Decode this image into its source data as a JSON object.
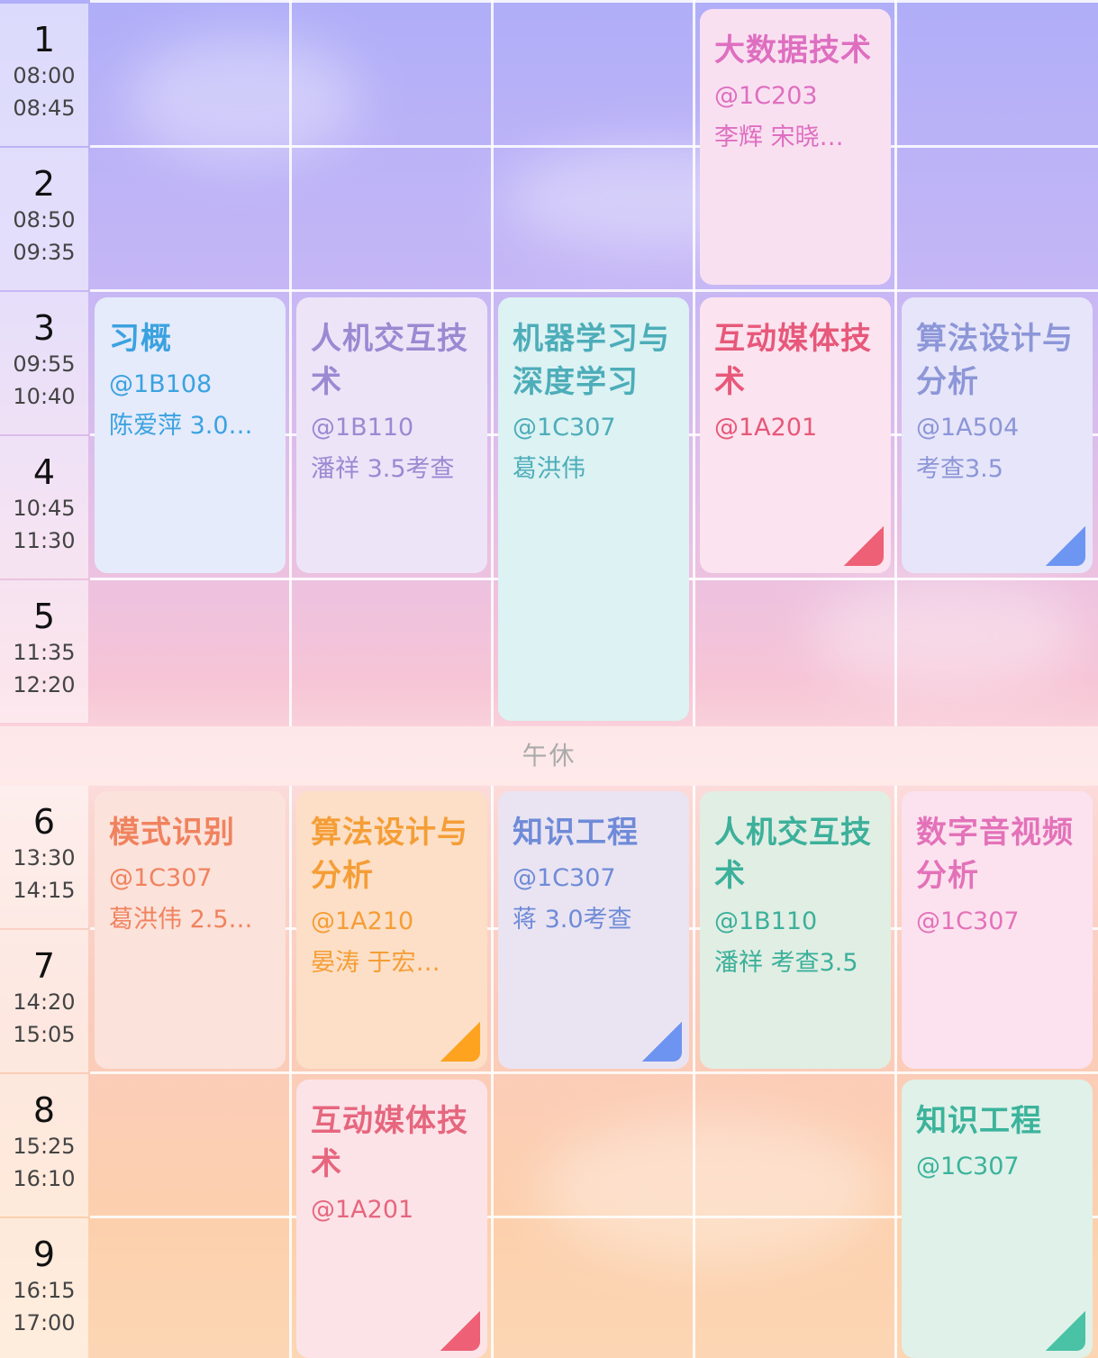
{
  "time_slots": [
    {
      "num": "1",
      "start": "08:00",
      "end": "08:45"
    },
    {
      "num": "2",
      "start": "08:50",
      "end": "09:35"
    },
    {
      "num": "3",
      "start": "09:55",
      "end": "10:40"
    },
    {
      "num": "4",
      "start": "10:45",
      "end": "11:30"
    },
    {
      "num": "5",
      "start": "11:35",
      "end": "12:20"
    },
    {
      "num": "6",
      "start": "13:30",
      "end": "14:15"
    },
    {
      "num": "7",
      "start": "14:20",
      "end": "15:05"
    },
    {
      "num": "8",
      "start": "15:25",
      "end": "16:10"
    },
    {
      "num": "9",
      "start": "16:15",
      "end": "17:00"
    }
  ],
  "lunch_label": "午休",
  "courses": [
    {
      "title": "大数据技术",
      "room": "@1C203",
      "extra": "李辉 宋晓…",
      "bg": "#f9e0f1",
      "fg": "#de6fc0",
      "corner": ""
    },
    {
      "title": "习概",
      "room": "@1B108",
      "extra": "陈爱萍 3.0…",
      "bg": "#e5ebfb",
      "fg": "#3ba2e0",
      "corner": ""
    },
    {
      "title": "人机交互技术",
      "room": "@1B110",
      "extra": "潘祥 3.5考查",
      "bg": "#eee4f8",
      "fg": "#9b89d2",
      "corner": ""
    },
    {
      "title": "机器学习与深度学习",
      "room": "@1C307",
      "extra": "葛洪伟",
      "bg": "#dcf2f3",
      "fg": "#4dadb9",
      "corner": ""
    },
    {
      "title": "互动媒体技术",
      "room": "@1A201",
      "extra": "",
      "bg": "#fbe3ef",
      "fg": "#e7587a",
      "corner": "#ee6076"
    },
    {
      "title": "算法设计与分析",
      "room": "@1A504",
      "extra": "考查3.5",
      "bg": "#e7e5f9",
      "fg": "#8c96d8",
      "corner": "#6d95f2"
    },
    {
      "title": "模式识别",
      "room": "@1C307",
      "extra": "葛洪伟 2.5…",
      "bg": "#fbe2db",
      "fg": "#f0825e",
      "corner": ""
    },
    {
      "title": "算法设计与分析",
      "room": "@1A210",
      "extra": "晏涛 于宏…",
      "bg": "#fcdfc6",
      "fg": "#f59d36",
      "corner": "#fda31f"
    },
    {
      "title": "知识工程",
      "room": "@1C307",
      "extra": "蒋 3.0考查",
      "bg": "#eae4f2",
      "fg": "#6f8bd8",
      "corner": "#6e94f1"
    },
    {
      "title": "人机交互技术",
      "room": "@1B110",
      "extra": "潘祥 考查3.5",
      "bg": "#e1eee4",
      "fg": "#3cb09a",
      "corner": ""
    },
    {
      "title": "数字音视频分析",
      "room": "@1C307",
      "extra": "",
      "bg": "#fce2ef",
      "fg": "#e372b9",
      "corner": ""
    },
    {
      "title": "互动媒体技术",
      "room": "@1A201",
      "extra": "",
      "bg": "#fce3e8",
      "fg": "#e6667e",
      "corner": "#ee6076"
    },
    {
      "title": "知识工程",
      "room": "@1C307",
      "extra": "",
      "bg": "#dff1e9",
      "fg": "#3cb39b",
      "corner": "#4ac2a5"
    }
  ]
}
